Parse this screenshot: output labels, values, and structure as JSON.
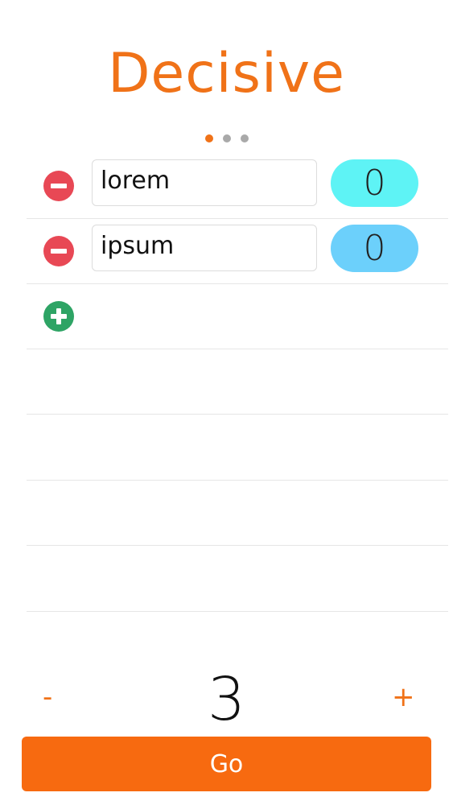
{
  "app": {
    "title": "Decisive",
    "accent_color": "#f07218",
    "page_indicator": {
      "total": 3,
      "active_index": 0
    }
  },
  "options": [
    {
      "label": "lorem",
      "count": "0",
      "pill_color": "#5ef3f5",
      "remove_icon": "minus-circle-icon"
    },
    {
      "label": "ipsum",
      "count": "0",
      "pill_color": "#6cd0fb",
      "remove_icon": "minus-circle-icon"
    }
  ],
  "add_option": {
    "icon": "plus-circle-icon",
    "color": "#2ea465"
  },
  "stepper": {
    "minus_label": "-",
    "value": "3",
    "plus_label": "+"
  },
  "go_button": {
    "label": "Go",
    "color": "#f76a10"
  }
}
